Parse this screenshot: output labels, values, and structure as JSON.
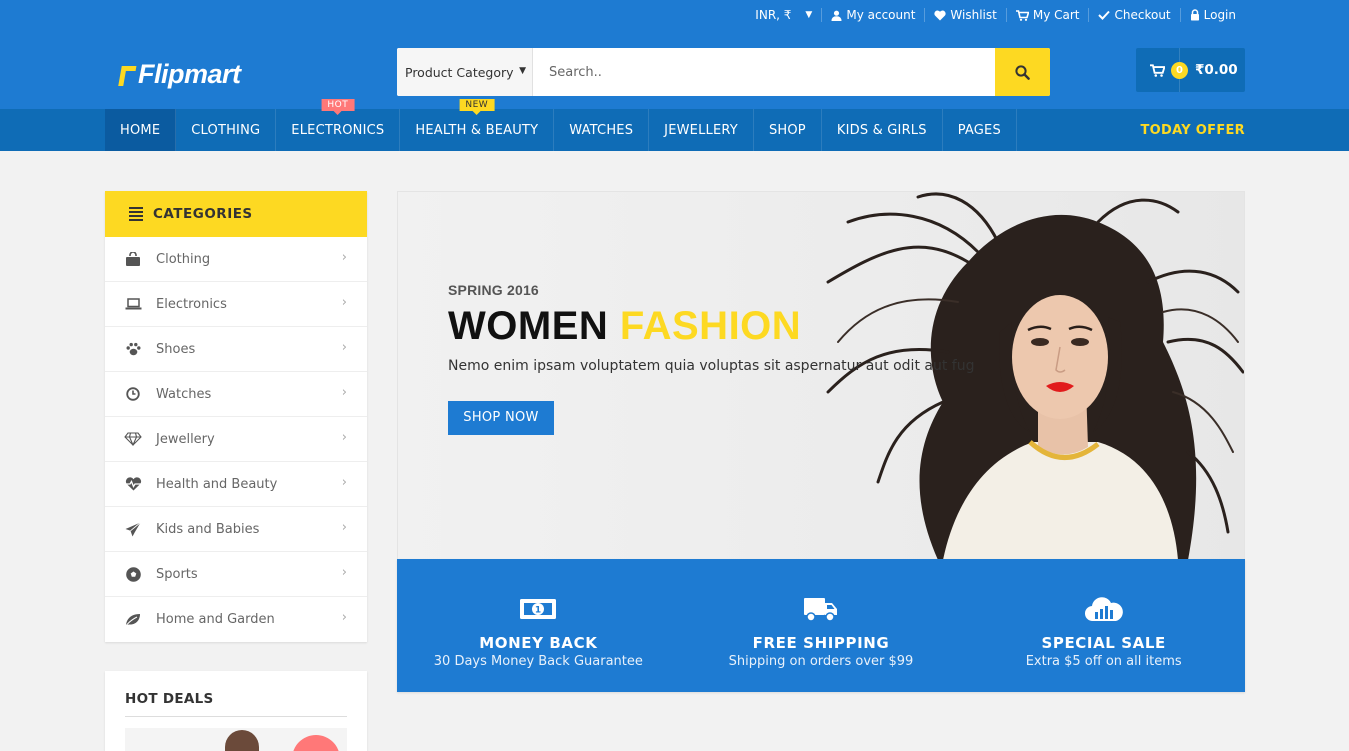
{
  "topbar": {
    "currency": "INR, ₹",
    "links": [
      {
        "icon": "user-icon",
        "label": "My account"
      },
      {
        "icon": "heart-icon",
        "label": "Wishlist"
      },
      {
        "icon": "cart-icon",
        "label": "My Cart"
      },
      {
        "icon": "check-icon",
        "label": "Checkout"
      },
      {
        "icon": "lock-icon",
        "label": "Login"
      }
    ]
  },
  "logo": {
    "text": "Flipmart"
  },
  "search": {
    "category_label": "Product Category",
    "placeholder": "Search..",
    "button_icon": "search-icon"
  },
  "cart": {
    "count": "0",
    "total": "₹0.00"
  },
  "nav": {
    "items": [
      {
        "label": "HOME",
        "active": true
      },
      {
        "label": "CLOTHING"
      },
      {
        "label": "ELECTRONICS",
        "tag": "HOT"
      },
      {
        "label": "HEALTH & BEAUTY",
        "tag": "NEW"
      },
      {
        "label": "WATCHES"
      },
      {
        "label": "JEWELLERY"
      },
      {
        "label": "SHOP"
      },
      {
        "label": "KIDS & GIRLS"
      },
      {
        "label": "PAGES"
      }
    ],
    "offer_label": "TODAY OFFER"
  },
  "categories": {
    "title": "CATEGORIES",
    "items": [
      {
        "icon": "shopping-bag-icon",
        "label": "Clothing"
      },
      {
        "icon": "laptop-icon",
        "label": "Electronics"
      },
      {
        "icon": "paw-icon",
        "label": "Shoes"
      },
      {
        "icon": "clock-icon",
        "label": "Watches"
      },
      {
        "icon": "diamond-icon",
        "label": "Jewellery"
      },
      {
        "icon": "heartbeat-icon",
        "label": "Health and Beauty"
      },
      {
        "icon": "paper-plane-icon",
        "label": "Kids and Babies"
      },
      {
        "icon": "futbol-icon",
        "label": "Sports"
      },
      {
        "icon": "leaf-icon",
        "label": "Home and Garden"
      }
    ]
  },
  "hot_deals": {
    "title": "HOT DEALS"
  },
  "hero": {
    "tagline": "SPRING 2016",
    "title_main": "WOMEN",
    "title_accent": "FASHION",
    "description": "Nemo enim ipsam voluptatem quia voluptas sit aspernatur aut odit aut fug",
    "button_label": "SHOP NOW"
  },
  "info_boxes": [
    {
      "icon": "money-icon",
      "title": "MONEY BACK",
      "subtitle": "30 Days Money Back Guarantee"
    },
    {
      "icon": "truck-icon",
      "title": "FREE SHIPPING",
      "subtitle": "Shipping on orders over $99"
    },
    {
      "icon": "cloud-chart-icon",
      "title": "SPECIAL SALE",
      "subtitle": "Extra $5 off on all items"
    }
  ],
  "colors": {
    "primary": "#1e7bd2",
    "primary_dark": "#0f6cb6",
    "accent": "#fdd922",
    "hot": "#ff7878"
  }
}
